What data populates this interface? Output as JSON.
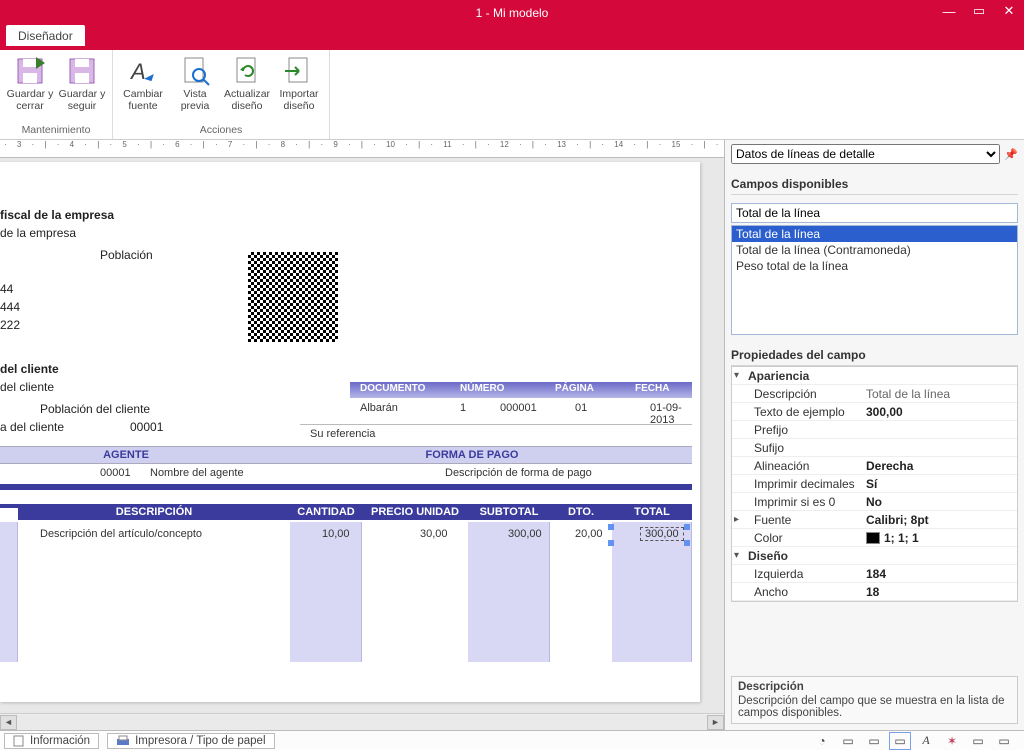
{
  "window": {
    "title": "1 - Mi modelo"
  },
  "ribbon": {
    "tab": "Diseñador",
    "groups": {
      "maint": {
        "label": "Mantenimiento",
        "save_close": "Guardar y cerrar",
        "save_cont": "Guardar y seguir"
      },
      "actions": {
        "label": "Acciones",
        "font": "Cambiar fuente",
        "preview": "Vista previa",
        "refresh": "Actualizar diseño",
        "import": "Importar diseño"
      }
    }
  },
  "doc": {
    "fiscal_title": "fiscal de la empresa",
    "fiscal_sub": "de la empresa",
    "poblacion": "Población",
    "n1": "44",
    "n2": "444",
    "n3": "222",
    "client_title": "del cliente",
    "client_sub": "del cliente",
    "client_pob": "Población del cliente",
    "client_code_label": "a del cliente",
    "client_code": "00001",
    "docinfo": {
      "h1": "DOCUMENTO",
      "h2": "NÚMERO",
      "h3": "PÁGINA",
      "h4": "FECHA",
      "v1": "Albarán",
      "v2a": "1",
      "v2b": "000001",
      "v3": "01",
      "v4": "01-09-2013",
      "ref": "Su referencia"
    },
    "agent": {
      "h1": "AGENTE",
      "h2": "FORMA DE PAGO",
      "code": "00001",
      "name": "Nombre del agente",
      "pay": "Descripción de forma de pago"
    },
    "cols": {
      "desc": "DESCRIPCIÓN",
      "qty": "CANTIDAD",
      "price": "PRECIO UNIDAD",
      "sub": "SUBTOTAL",
      "dto": "DTO.",
      "total": "TOTAL"
    },
    "line": {
      "desc": "Descripción del artículo/concepto",
      "qty": "10,00",
      "price": "30,00",
      "sub": "300,00",
      "dto": "20,00",
      "total": "300,00"
    }
  },
  "side": {
    "combo": "Datos de líneas de detalle",
    "fields_title": "Campos disponibles",
    "search": "Total de la línea",
    "options": [
      "Total de la línea",
      "Total de la línea  (Contramoneda)",
      "Peso total de la línea"
    ],
    "props_title": "Propiedades del campo",
    "props": {
      "cat_appearance": "Apariencia",
      "description_k": "Descripción",
      "description_v": "Total de la línea",
      "sample_k": "Texto de ejemplo",
      "sample_v": "300,00",
      "prefix_k": "Prefijo",
      "suffix_k": "Sufijo",
      "align_k": "Alineación",
      "align_v": "Derecha",
      "decimals_k": "Imprimir decimales",
      "decimals_v": "Sí",
      "printzero_k": "Imprimir si es 0",
      "printzero_v": "No",
      "font_k": "Fuente",
      "font_v": "Calibri; 8pt",
      "color_k": "Color",
      "color_v": "1; 1; 1",
      "cat_design": "Diseño",
      "left_k": "Izquierda",
      "left_v": "184",
      "width_k": "Ancho",
      "width_v": "18"
    },
    "desc_title": "Descripción",
    "desc_text": "Descripción del campo que se muestra en la lista de campos disponibles."
  },
  "status": {
    "info": "Información",
    "printer": "Impresora / Tipo de papel"
  }
}
